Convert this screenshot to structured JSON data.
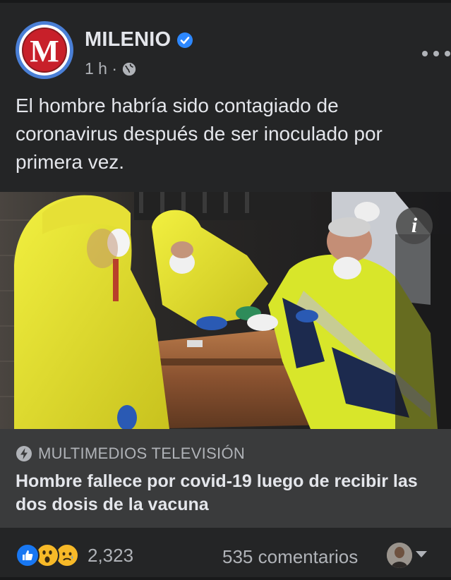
{
  "post": {
    "page_name": "MILENIO",
    "avatar_letter": "M",
    "time": "1 h ·",
    "text": "El hombre habría sido contagiado de coronavirus después de ser inoculado por primera vez.",
    "verified_icon": "verified-badge-icon",
    "audience_icon": "globe-icon",
    "more_icon": "more-options-icon"
  },
  "image": {
    "info_label": "i"
  },
  "link_preview": {
    "source_icon": "bolt-icon",
    "source": "MULTIMEDIOS TELEVISIÓN",
    "title": "Hombre fallece por covid-19 luego de recibir las dos dosis de la vacuna"
  },
  "footer": {
    "reactions": [
      "like",
      "wow",
      "sad"
    ],
    "reaction_count": "2,323",
    "comments": "535 comentarios"
  },
  "colors": {
    "background": "#242526",
    "link_preview_bg": "#3a3b3c",
    "text_primary": "#e4e6eb",
    "text_secondary": "#b0b3b8",
    "accent_blue": "#1877f2",
    "brand_red": "#c8202a"
  }
}
